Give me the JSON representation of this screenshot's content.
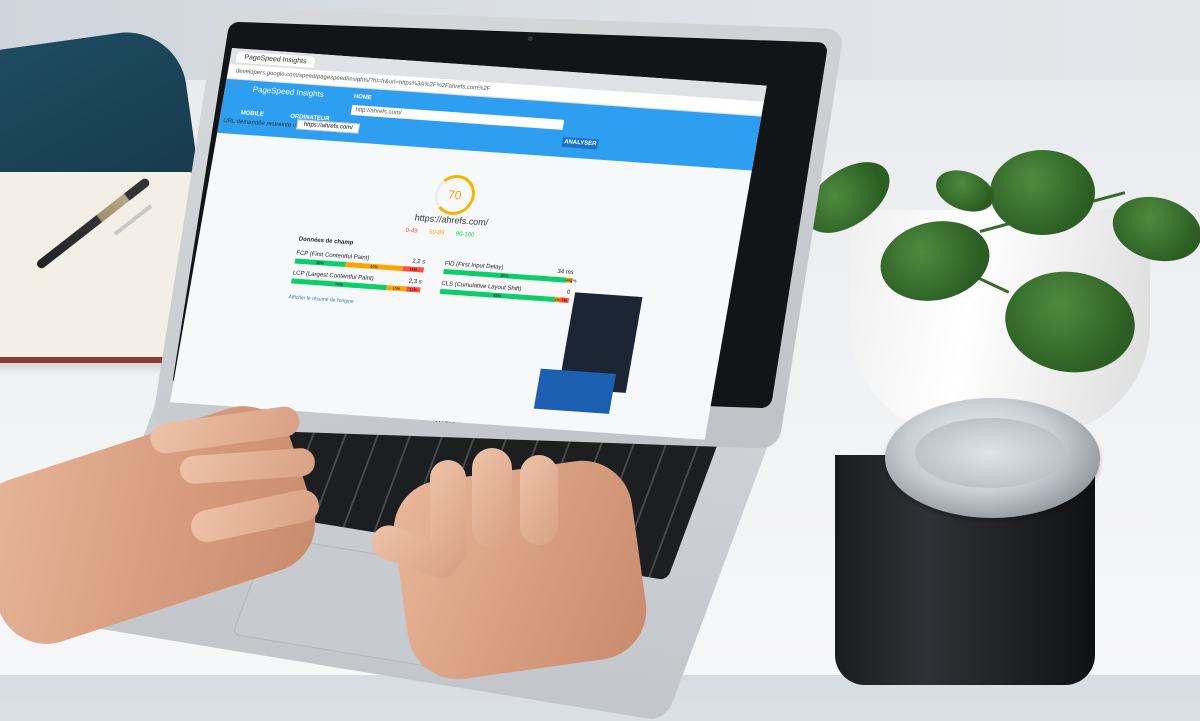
{
  "laptop": {
    "brand": "MacBook Air"
  },
  "browser": {
    "tab_title": "PageSpeed Insights",
    "url": "developers.google.com/speed/pagespeed/insights/?hl=fr&url=https%3A%2F%2Fahrefs.com%2F"
  },
  "psi": {
    "app_title": "PageSpeed Insights",
    "nav_home": "HOME",
    "input_value": "http://ahrefs.com/",
    "analyze_button": "ANALYSER",
    "device_mobile": "MOBILE",
    "device_desktop": "ORDINATEUR",
    "restrict_label": "URL demandée restreinte vers",
    "restrict_url": "https://ahrefs.com/",
    "score": "70",
    "site": "https://ahrefs.com/",
    "legend": [
      "0-49",
      "50-89",
      "90-100"
    ],
    "field_data_title": "Données de champ",
    "show_origin": "Afficher le résumé de l'origine",
    "metrics": [
      {
        "label": "FCP (First Contentful Paint)",
        "value": "2,2 s",
        "good": "39%",
        "mid": "45%",
        "poor": "16%"
      },
      {
        "label": "FID (First Input Delay)",
        "value": "34 ms",
        "good": "95%",
        "mid": "4%",
        "poor": "1%"
      },
      {
        "label": "LCP (Largest Contentful Paint)",
        "value": "2,3 s",
        "good": "74%",
        "mid": "15%",
        "poor": "11%"
      },
      {
        "label": "CLS (Cumulative Layout Shift)",
        "value": "0",
        "good": "89%",
        "mid": "4%",
        "poor": "7%"
      }
    ]
  },
  "colors": {
    "psi_blue": "#2d9ef0",
    "good": "#0cce6b",
    "average": "#ffa400",
    "poor": "#ff4e42",
    "score_orange": "#f49b00"
  }
}
